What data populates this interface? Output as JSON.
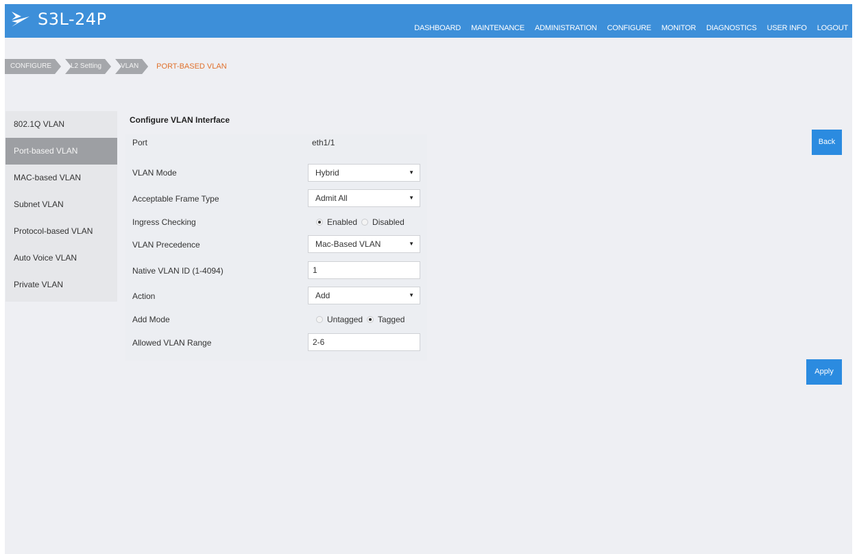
{
  "header": {
    "product": "S3L-24P",
    "nav": [
      "DASHBOARD",
      "MAINTENANCE",
      "ADMINISTRATION",
      "CONFIGURE",
      "MONITOR",
      "DIAGNOSTICS",
      "USER INFO",
      "LOGOUT"
    ]
  },
  "breadcrumb": {
    "items": [
      "CONFIGURE",
      "L2 Setting",
      "VLAN"
    ],
    "current": "PORT-BASED VLAN"
  },
  "sidebar": {
    "items": [
      {
        "label": "802.1Q VLAN"
      },
      {
        "label": "Port-based VLAN"
      },
      {
        "label": "MAC-based VLAN"
      },
      {
        "label": "Subnet VLAN"
      },
      {
        "label": "Protocol-based VLAN"
      },
      {
        "label": "Auto Voice VLAN"
      },
      {
        "label": "Private VLAN"
      }
    ],
    "active_index": 1
  },
  "form": {
    "title": "Configure VLAN Interface",
    "port": {
      "label": "Port",
      "value": "eth1/1"
    },
    "vlan_mode": {
      "label": "VLAN Mode",
      "value": "Hybrid"
    },
    "frame_type": {
      "label": "Acceptable Frame Type",
      "value": "Admit All"
    },
    "ingress": {
      "label": "Ingress Checking",
      "option1": "Enabled",
      "option2": "Disabled",
      "selected": "Enabled"
    },
    "precedence": {
      "label": "VLAN Precedence",
      "value": "Mac-Based VLAN"
    },
    "native_vlan": {
      "label": "Native VLAN ID (1-4094)",
      "value": "1"
    },
    "action": {
      "label": "Action",
      "value": "Add"
    },
    "add_mode": {
      "label": "Add Mode",
      "option1": "Untagged",
      "option2": "Tagged",
      "selected": "Tagged"
    },
    "allowed_range": {
      "label": "Allowed VLAN Range",
      "value": "2-6"
    }
  },
  "buttons": {
    "back": "Back",
    "apply": "Apply"
  },
  "colors": {
    "accent": "#3d8fd9",
    "button": "#2b8be0",
    "current_crumb": "#e0702b"
  }
}
